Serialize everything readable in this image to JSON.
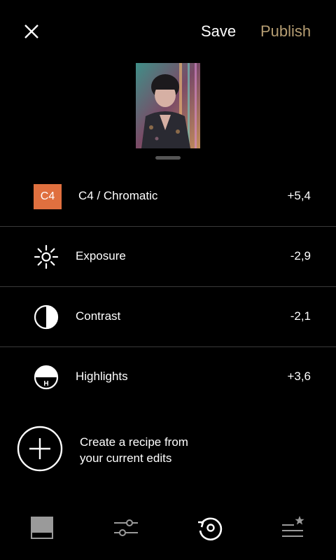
{
  "header": {
    "save_label": "Save",
    "publish_label": "Publish",
    "close_icon": "close-icon",
    "accent_color": "#b59d72"
  },
  "preview": {
    "image_icon": "photo-thumbnail"
  },
  "recipe": {
    "items": [
      {
        "badge": "C4",
        "label": "C4 / Chromatic",
        "value": "+5,4",
        "icon": "preset-badge",
        "badge_color": "#e0703f"
      },
      {
        "label": "Exposure",
        "value": "-2,9",
        "icon": "exposure-icon"
      },
      {
        "label": "Contrast",
        "value": "-2,1",
        "icon": "contrast-icon"
      },
      {
        "label": "Highlights",
        "value": "+3,6",
        "icon": "highlights-icon",
        "icon_letter": "H"
      }
    ]
  },
  "create_recipe": {
    "line1": "Create a recipe from",
    "line2": "your current edits",
    "icon": "plus-circle-icon"
  },
  "bottom_nav": {
    "items": [
      {
        "icon": "presets-icon"
      },
      {
        "icon": "tools-icon"
      },
      {
        "icon": "history-icon"
      },
      {
        "icon": "recipes-icon"
      }
    ]
  }
}
